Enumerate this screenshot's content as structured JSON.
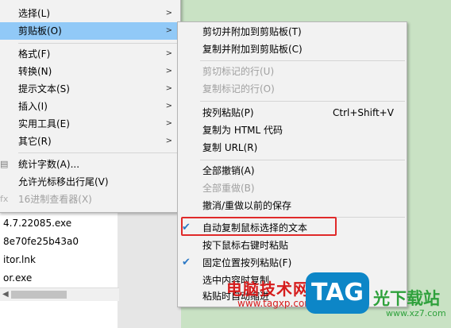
{
  "background_files": [
    "4.7.22085.exe",
    "8e70fe25b43a0",
    "itor.lnk",
    "or.exe"
  ],
  "main_menu": {
    "items": [
      {
        "label": "选择(L)"
      },
      {
        "label": "剪贴板(O)"
      },
      {
        "label": "格式(F)"
      },
      {
        "label": "转换(N)"
      },
      {
        "label": "提示文本(S)"
      },
      {
        "label": "插入(I)"
      },
      {
        "label": "实用工具(E)"
      },
      {
        "label": "其它(R)"
      },
      {
        "label": "统计字数(A)..."
      },
      {
        "label": "允许光标移出行尾(V)"
      },
      {
        "label": "16进制查看器(X)"
      }
    ],
    "highlighted": "剪贴板(O)"
  },
  "clipboard_submenu": {
    "items": [
      {
        "label": "剪切并附加到剪贴板(T)"
      },
      {
        "label": "复制并附加到剪贴板(C)"
      },
      {
        "label": "剪切标记的行(U)"
      },
      {
        "label": "复制标记的行(O)"
      },
      {
        "label": "按列粘贴(P)",
        "shortcut": "Ctrl+Shift+V"
      },
      {
        "label": "复制为 HTML 代码"
      },
      {
        "label": "复制 URL(R)"
      },
      {
        "label": "全部撤销(A)"
      },
      {
        "label": "全部重做(B)"
      },
      {
        "label": "撤消/重做以前的保存"
      },
      {
        "label": "自动复制鼠标选择的文本",
        "checked": true
      },
      {
        "label": "按下鼠标右键时粘贴"
      },
      {
        "label": "固定位置按列粘贴(F)",
        "checked": true
      },
      {
        "label": "选中内容时复制"
      },
      {
        "label": "粘贴时自动缩进"
      }
    ]
  },
  "watermark": {
    "site_name": "电脑技术网",
    "site_url": "www.tagxp.com",
    "logo_text": "TAG",
    "brand_text": "光下载站",
    "brand_url": "www.xz7.com"
  },
  "colors": {
    "highlight": "#91c9f7",
    "menu_bg": "#f2f2f2",
    "desktop_bg": "#c9e2c4",
    "annotation_box": "#e02a2a",
    "check": "#2b78c5"
  }
}
